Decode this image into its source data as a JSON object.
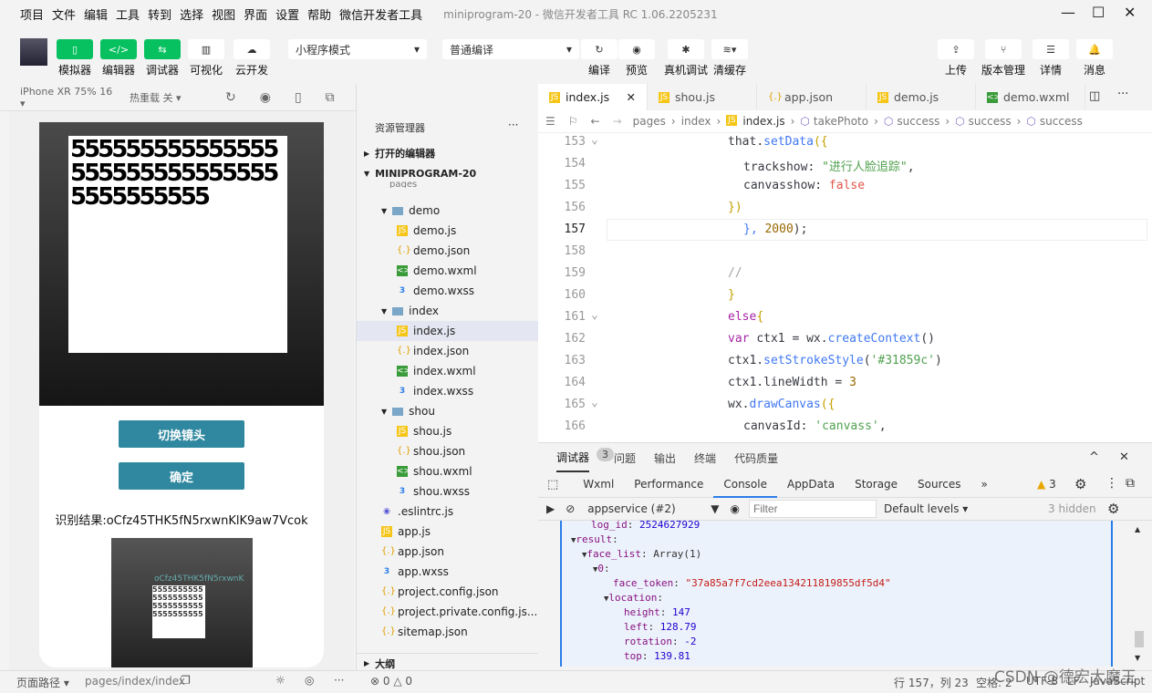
{
  "menu": [
    "项目",
    "文件",
    "编辑",
    "工具",
    "转到",
    "选择",
    "视图",
    "界面",
    "设置",
    "帮助",
    "微信开发者工具"
  ],
  "window_title": "miniprogram-20 - 微信开发者工具 RC 1.06.2205231",
  "toolbar": {
    "left": [
      {
        "icon": "phone-icon",
        "label": "模拟器",
        "green": true
      },
      {
        "icon": "code-icon",
        "label": "编辑器",
        "green": true
      },
      {
        "icon": "debug-sliders-icon",
        "label": "调试器",
        "green": true
      },
      {
        "icon": "layout-icon",
        "label": "可视化"
      },
      {
        "icon": "cloud-icon",
        "label": "云开发"
      }
    ],
    "mode": "小程序模式",
    "compile": "普通编译",
    "right": [
      {
        "icon": "refresh-icon",
        "label": "编译"
      },
      {
        "icon": "eye-icon",
        "label": "预览"
      },
      {
        "icon": "bug-icon",
        "label": "真机调试"
      },
      {
        "icon": "layers-icon",
        "label": "清缓存"
      },
      {
        "icon": "upload-icon",
        "label": "上传"
      },
      {
        "icon": "branch-icon",
        "label": "版本管理"
      },
      {
        "icon": "menu-icon",
        "label": "详情"
      },
      {
        "icon": "bell-icon",
        "label": "消息"
      }
    ]
  },
  "sim": {
    "device": "iPhone XR 75% 16 ▾",
    "hot_reload": "热重载 关 ▾",
    "btn_switch": "切换镜头",
    "btn_ok": "确定",
    "result": "识别结果:oCfz45THK5fN5rxwnKlK9aw7Vcok",
    "overlay_text": "oCfz45THK5fN5rxwnK",
    "meme_text": "5555555555555555555555555555555555555555"
  },
  "explorer": {
    "title": "资源管理器",
    "more": "···",
    "open_editors": "打开的编辑器",
    "project": "MINIPROGRAM-20",
    "outline": "大纲",
    "items": [
      {
        "name": "pages",
        "type": "folder",
        "depth": 0
      },
      {
        "name": "demo",
        "type": "folder",
        "depth": 1
      },
      {
        "name": "demo.js",
        "type": "js",
        "depth": 2
      },
      {
        "name": "demo.json",
        "type": "json",
        "depth": 2
      },
      {
        "name": "demo.wxml",
        "type": "wxml",
        "depth": 2
      },
      {
        "name": "demo.wxss",
        "type": "wxss",
        "depth": 2
      },
      {
        "name": "index",
        "type": "folder",
        "depth": 1
      },
      {
        "name": "index.js",
        "type": "js",
        "depth": 2,
        "active": true
      },
      {
        "name": "index.json",
        "type": "json",
        "depth": 2
      },
      {
        "name": "index.wxml",
        "type": "wxml",
        "depth": 2
      },
      {
        "name": "index.wxss",
        "type": "wxss",
        "depth": 2
      },
      {
        "name": "shou",
        "type": "folder",
        "depth": 1
      },
      {
        "name": "shou.js",
        "type": "js",
        "depth": 2
      },
      {
        "name": "shou.json",
        "type": "json",
        "depth": 2
      },
      {
        "name": "shou.wxml",
        "type": "wxml",
        "depth": 2
      },
      {
        "name": "shou.wxss",
        "type": "wxss",
        "depth": 2
      },
      {
        "name": ".eslintrc.js",
        "type": "eslint",
        "depth": 1
      },
      {
        "name": "app.js",
        "type": "js",
        "depth": 1
      },
      {
        "name": "app.json",
        "type": "json",
        "depth": 1
      },
      {
        "name": "app.wxss",
        "type": "wxss",
        "depth": 1
      },
      {
        "name": "project.config.json",
        "type": "json",
        "depth": 1
      },
      {
        "name": "project.private.config.js...",
        "type": "json",
        "depth": 1
      },
      {
        "name": "sitemap.json",
        "type": "json",
        "depth": 1
      }
    ]
  },
  "tabs": [
    {
      "name": "index.js",
      "type": "js",
      "active": true
    },
    {
      "name": "shou.js",
      "type": "js"
    },
    {
      "name": "app.json",
      "type": "json"
    },
    {
      "name": "demo.js",
      "type": "js"
    },
    {
      "name": "demo.wxml",
      "type": "wxml"
    }
  ],
  "breadcrumb": [
    "pages",
    "index",
    "index.js",
    "takePhoto",
    "success",
    "success",
    "success"
  ],
  "code": [
    {
      "n": "153",
      "i": 0,
      "t": [
        [
          "that",
          "p"
        ],
        [
          ".",
          ""
        ],
        [
          "setData",
          "f"
        ],
        [
          "({",
          "b"
        ]
      ]
    },
    {
      "n": "154",
      "i": 1,
      "t": [
        [
          "trackshow: ",
          "p"
        ],
        [
          "\"进行人脸追踪\"",
          "s"
        ],
        [
          ",",
          "p"
        ]
      ]
    },
    {
      "n": "155",
      "i": 1,
      "t": [
        [
          "canvasshow: ",
          "p"
        ],
        [
          "false",
          "v"
        ]
      ]
    },
    {
      "n": "156",
      "i": 0,
      "t": [
        [
          "})",
          "b"
        ]
      ]
    },
    {
      "n": "157",
      "i": 1,
      "t": [
        [
          "}, ",
          "f"
        ],
        [
          "2000",
          "n"
        ],
        [
          ");",
          "p"
        ]
      ]
    },
    {
      "n": "158",
      "i": 0,
      "t": []
    },
    {
      "n": "159",
      "i": 0,
      "t": [
        [
          "//",
          "c"
        ]
      ]
    },
    {
      "n": "160",
      "i": 0,
      "t": [
        [
          "}",
          "b"
        ]
      ]
    },
    {
      "n": "161",
      "i": 0,
      "t": [
        [
          "else",
          "k"
        ],
        [
          "{",
          "b"
        ]
      ]
    },
    {
      "n": "162",
      "i": 0,
      "t": [
        [
          "var ",
          "k"
        ],
        [
          "ctx1 = wx.",
          "p"
        ],
        [
          "createContext",
          "f"
        ],
        [
          "()",
          "p"
        ]
      ]
    },
    {
      "n": "163",
      "i": 0,
      "t": [
        [
          "ctx1.",
          "p"
        ],
        [
          "setStrokeStyle",
          "f"
        ],
        [
          "(",
          "p"
        ],
        [
          "'#31859c'",
          "s"
        ],
        [
          ")",
          "p"
        ]
      ]
    },
    {
      "n": "164",
      "i": 0,
      "t": [
        [
          "ctx1.lineWidth = ",
          "p"
        ],
        [
          "3",
          "n"
        ]
      ]
    },
    {
      "n": "165",
      "i": 0,
      "t": [
        [
          "wx.",
          "p"
        ],
        [
          "drawCanvas",
          "f"
        ],
        [
          "({",
          "b"
        ]
      ]
    },
    {
      "n": "166",
      "i": 1,
      "t": [
        [
          "canvasId: ",
          "p"
        ],
        [
          "'canvass'",
          "s"
        ],
        [
          ",",
          "p"
        ]
      ]
    }
  ],
  "devtools": {
    "panel_tabs": [
      "调试器",
      "问题",
      "输出",
      "终端",
      "代码质量"
    ],
    "badge": "3",
    "tabs": [
      "Wxml",
      "Performance",
      "Console",
      "AppData",
      "Storage",
      "Sources",
      "»"
    ],
    "active_tab": "Console",
    "warnings": "3",
    "context": "appservice (#2)",
    "filter_placeholder": "Filter",
    "levels": "Default levels ▾",
    "hidden": "3 hidden",
    "console": [
      {
        "i": 1,
        "k": "log_id",
        "v": "2524627929",
        "t": "num"
      },
      {
        "i": 0,
        "arrow": true,
        "k": "result",
        "v": "",
        "t": ""
      },
      {
        "i": 1,
        "arrow": true,
        "k": "face_list",
        "v": "Array(1)",
        "t": ""
      },
      {
        "i": 2,
        "arrow": true,
        "k": "0",
        "v": "",
        "t": ""
      },
      {
        "i": 3,
        "k": "face_token",
        "v": "\"37a85a7f7cd2eea134211819855df5d4\"",
        "t": "str"
      },
      {
        "i": 3,
        "arrow": true,
        "k": "location",
        "v": "",
        "t": ""
      },
      {
        "i": 4,
        "k": "height",
        "v": "147",
        "t": "num"
      },
      {
        "i": 4,
        "k": "left",
        "v": "128.79",
        "t": "num"
      },
      {
        "i": 4,
        "k": "rotation",
        "v": "-2",
        "t": "num"
      },
      {
        "i": 4,
        "k": "top",
        "v": "139.81",
        "t": "num"
      }
    ]
  },
  "status": {
    "page_path": "页面路径 ▾",
    "path": "pages/index/index",
    "errors": "⊗ 0 △ 0",
    "cursor": "行 157，列 23",
    "spaces": "空格: 2",
    "encoding": "UTF-8",
    "eol": "LF",
    "lang": "JavaScript"
  },
  "watermark": "CSDN @德宏大魔王"
}
